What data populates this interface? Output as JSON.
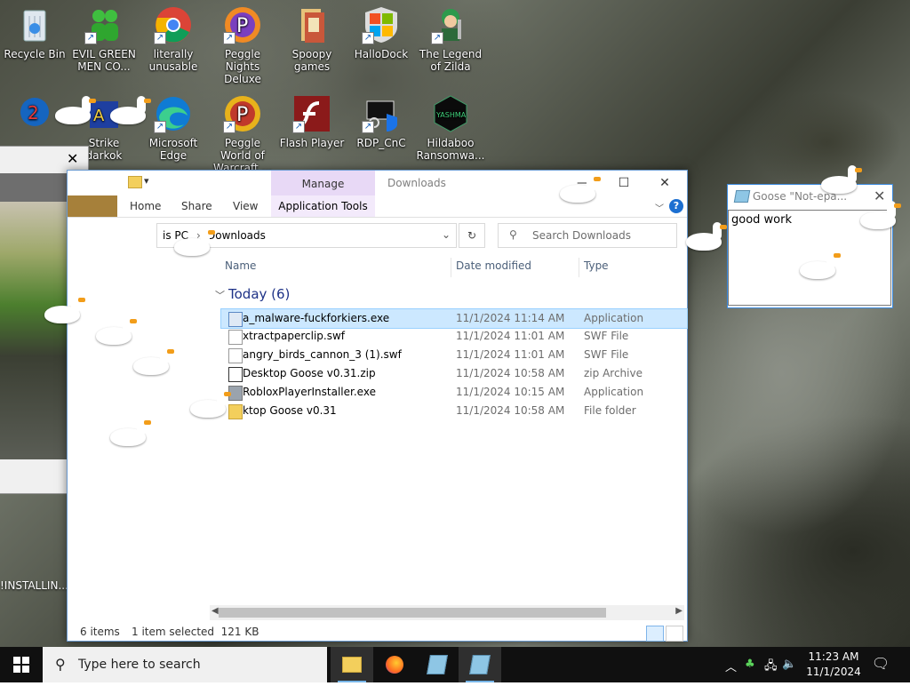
{
  "desktop": {
    "icons": [
      {
        "label": "Recycle Bin",
        "icon": "recycle-bin-icon"
      },
      {
        "label": "EVIL GREEN MEN CO...",
        "icon": "green-men-icon"
      },
      {
        "label": "literally unusable",
        "icon": "chrome-icon"
      },
      {
        "label": "Peggle Nights Deluxe",
        "icon": "peggle-icon"
      },
      {
        "label": "Spoopy games",
        "icon": "folder-icon"
      },
      {
        "label": "HalloDock",
        "icon": "windows-logo-icon"
      },
      {
        "label": "The Legend of Zilda",
        "icon": "zelda-icon"
      },
      {
        "label": "Strike darkok",
        "icon": "game-icon"
      },
      {
        "label": "Microsoft Edge",
        "icon": "edge-icon"
      },
      {
        "label": "Peggle World of Warcraft ...",
        "icon": "peggle-icon"
      },
      {
        "label": "Flash Player",
        "icon": "flash-icon"
      },
      {
        "label": "RDP_CnC",
        "icon": "rdp-icon"
      },
      {
        "label": "Hildaboo Ransomwa...",
        "icon": "yashma-icon"
      },
      {
        "label": "!INSTALLIN...",
        "icon": "installer-icon"
      }
    ],
    "yashma_text": "YASHMA"
  },
  "explorer": {
    "manage_tab": "Manage",
    "title": "Downloads",
    "ribbon_tabs": [
      "Home",
      "Share",
      "View"
    ],
    "app_tools": "Application Tools",
    "address": {
      "prefix": "is PC",
      "sep": "›",
      "folder": "Downloads"
    },
    "search_placeholder": "Search Downloads",
    "columns": {
      "name": "Name",
      "date": "Date modified",
      "type": "Type"
    },
    "group": {
      "label": "Today (6)"
    },
    "files": [
      {
        "name": "a_malware-fuckforkiers.exe",
        "date": "11/1/2024 11:14 AM",
        "type": "Application",
        "selected": true
      },
      {
        "name": "xtractpaperclip.swf",
        "date": "11/1/2024 11:01 AM",
        "type": "SWF File"
      },
      {
        "name": "angry_birds_cannon_3 (1).swf",
        "date": "11/1/2024 11:01 AM",
        "type": "SWF File"
      },
      {
        "name": "Desktop Goose v0.31.zip",
        "date": "11/1/2024 10:58 AM",
        "type": "zip Archive"
      },
      {
        "name": "RobloxPlayerInstaller.exe",
        "date": "11/1/2024 10:15 AM",
        "type": "Application"
      },
      {
        "name": "ktop Goose v0.31",
        "date": "11/1/2024 10:58 AM",
        "type": "File folder"
      }
    ],
    "status": {
      "items": "6 items",
      "selected": "1 item selected  121 KB"
    }
  },
  "goose_window": {
    "title": "Goose \"Not-epa...",
    "note": "good work"
  },
  "taskbar": {
    "search_placeholder": "Type here to search",
    "time": "11:23 AM",
    "date": "11/1/2024"
  }
}
